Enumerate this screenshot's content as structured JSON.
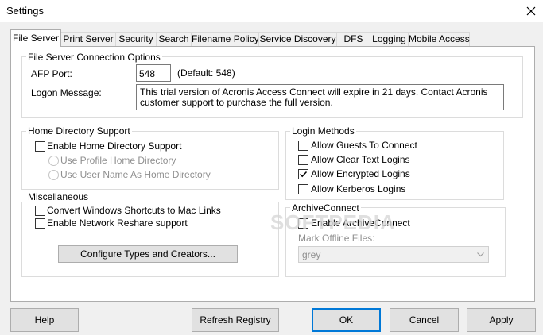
{
  "window": {
    "title": "Settings"
  },
  "tabs": [
    {
      "label": "File Server"
    },
    {
      "label": "Print Server"
    },
    {
      "label": "Security"
    },
    {
      "label": "Search"
    },
    {
      "label": "Filename Policy"
    },
    {
      "label": "Service Discovery"
    },
    {
      "label": "DFS"
    },
    {
      "label": "Logging"
    },
    {
      "label": "Mobile Access"
    }
  ],
  "connection": {
    "group_label": "File Server Connection Options",
    "afp_port_label": "AFP Port:",
    "afp_port_value": "548",
    "afp_default": "(Default: 548)",
    "logon_label": "Logon Message:",
    "logon_message": "This trial version of Acronis Access Connect will expire in 21 days. Contact Acronis customer support to purchase the full version."
  },
  "home_dir": {
    "group_label": "Home Directory Support",
    "enable_label": "Enable Home Directory Support",
    "enable_checked": false,
    "profile_label": "Use Profile Home Directory",
    "username_label": "Use User Name As Home Directory"
  },
  "login_methods": {
    "group_label": "Login Methods",
    "items": [
      {
        "label": "Allow Guests To Connect",
        "checked": false
      },
      {
        "label": "Allow Clear Text Logins",
        "checked": false
      },
      {
        "label": "Allow Encrypted Logins",
        "checked": true
      },
      {
        "label": "Allow Kerberos Logins",
        "checked": false
      }
    ]
  },
  "misc": {
    "group_label": "Miscellaneous",
    "shortcuts_label": "Convert Windows Shortcuts to Mac Links",
    "reshare_label": "Enable Network Reshare support",
    "configure_button": "Configure Types and Creators..."
  },
  "archive": {
    "group_label": "ArchiveConnect",
    "enable_label": "Enable ArchiveConnect",
    "offline_label": "Mark Offline Files:",
    "offline_value": "grey"
  },
  "watermark": "SOFTPEDIA",
  "buttons": {
    "help": "Help",
    "refresh": "Refresh Registry",
    "ok": "OK",
    "cancel": "Cancel",
    "apply": "Apply"
  }
}
